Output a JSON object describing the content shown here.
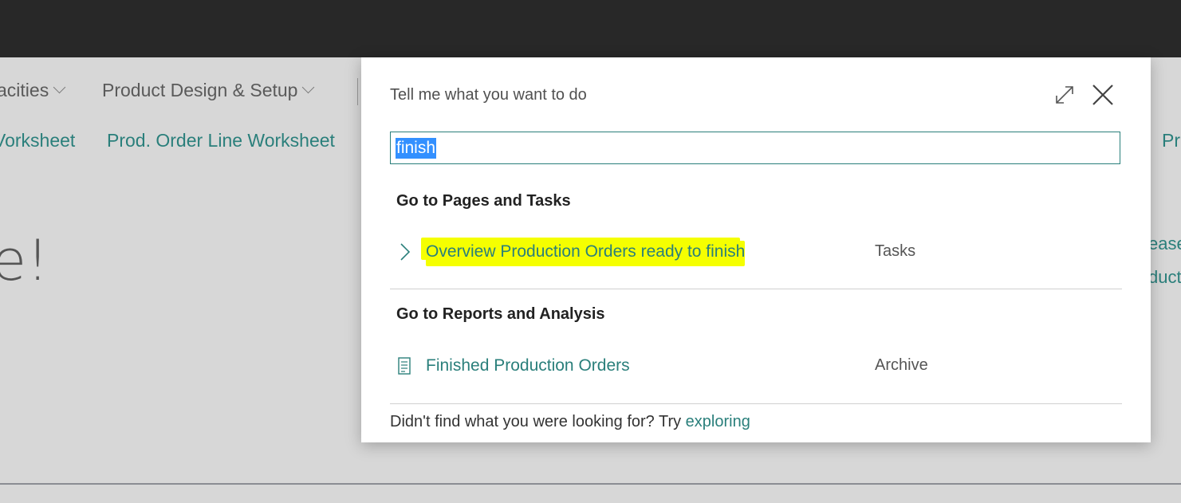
{
  "background": {
    "nav_menus": [
      {
        "label": "acities"
      },
      {
        "label": "Product Design & Setup"
      }
    ],
    "links": [
      {
        "label": "Vorksheet"
      },
      {
        "label": "Prod. Order Line Worksheet"
      },
      {
        "label": "Pr"
      }
    ],
    "heading_fragment": "e!",
    "right_fragments": [
      "ease",
      "duct"
    ]
  },
  "dialog": {
    "title": "Tell me what you want to do",
    "search": {
      "value": "finish"
    },
    "sections": [
      {
        "header": "Go to Pages and Tasks",
        "results": [
          {
            "label": "Overview Production Orders ready to finish",
            "category": "Tasks",
            "icon": "chevron-right-icon",
            "highlighted": true
          }
        ]
      },
      {
        "header": "Go to Reports and Analysis",
        "results": [
          {
            "label": "Finished Production Orders",
            "category": "Archive",
            "icon": "report-icon",
            "highlighted": false
          }
        ]
      }
    ],
    "footer": {
      "text": "Didn't find what you were looking for? Try ",
      "link": "exploring"
    }
  },
  "colors": {
    "accent": "#2a7f7b",
    "highlight": "#f5ff00",
    "selection": "#3390ff",
    "topbar": "#282828"
  }
}
